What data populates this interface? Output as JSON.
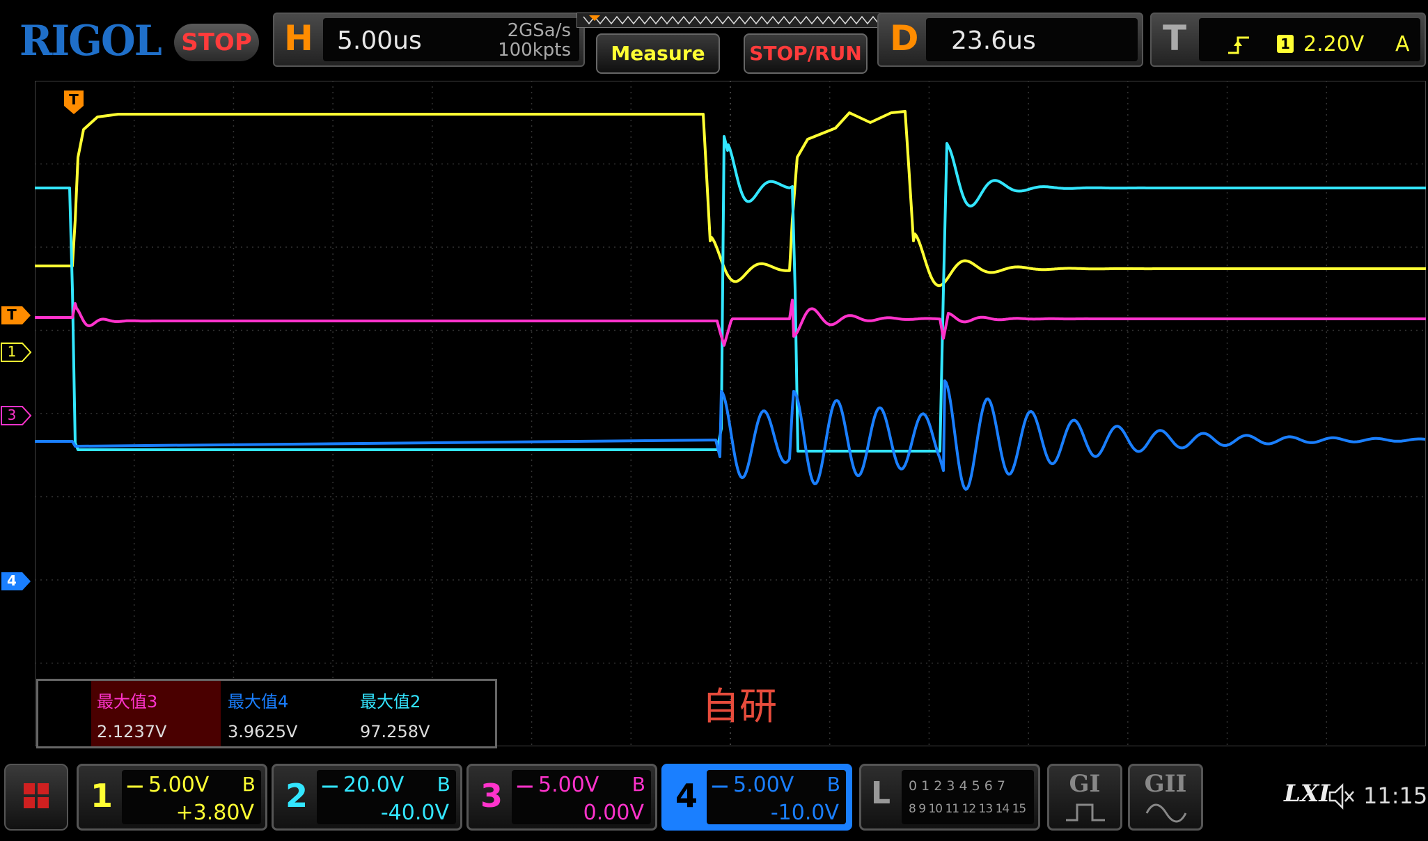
{
  "brand": "RIGOL",
  "run_state": "STOP",
  "horizontal": {
    "letter": "H",
    "timebase": "5.00us",
    "sample_rate": "2GSa/s",
    "memory_depth": "100kpts"
  },
  "buttons": {
    "measure": "Measure",
    "stop_run": "STOP/RUN"
  },
  "delay": {
    "letter": "D",
    "value": "23.6us"
  },
  "trigger": {
    "letter": "T",
    "source": "1",
    "level": "2.20V",
    "mode": "A",
    "marker": "T"
  },
  "channel_markers": [
    {
      "label": "T",
      "color": "#ff8c00"
    },
    {
      "label": "1",
      "color": "#ffff33"
    },
    {
      "label": "3",
      "color": "#ff33cc"
    },
    {
      "label": "4",
      "color": "#1a7fff"
    }
  ],
  "measurements": [
    {
      "name": "最大值3",
      "value": "2.1237V",
      "color": "#ff33cc"
    },
    {
      "name": "最大值4",
      "value": "3.9625V",
      "color": "#1a7fff"
    },
    {
      "name": "最大值2",
      "value": "97.258V",
      "color": "#33e6ff"
    }
  ],
  "watermark": "自研",
  "channels": [
    {
      "num": "1",
      "scale": "5.00V",
      "bw": "B",
      "offset": "+3.80V",
      "color": "#ffff33"
    },
    {
      "num": "2",
      "scale": "20.0V",
      "bw": "B",
      "offset": "-40.0V",
      "color": "#33e6ff"
    },
    {
      "num": "3",
      "scale": "5.00V",
      "bw": "B",
      "offset": "0.00V",
      "color": "#ff33cc"
    },
    {
      "num": "4",
      "scale": "5.00V",
      "bw": "B",
      "offset": "-10.0V",
      "color": "#1a7fff"
    }
  ],
  "logic": {
    "letter": "L",
    "row1": "0 1 2 3  4 5 6 7",
    "row2": "8 9 10 11 12 13 14 15"
  },
  "generators": [
    {
      "label": "GI"
    },
    {
      "label": "GII"
    }
  ],
  "status": {
    "lxi": "LXI",
    "time": "11:15"
  }
}
